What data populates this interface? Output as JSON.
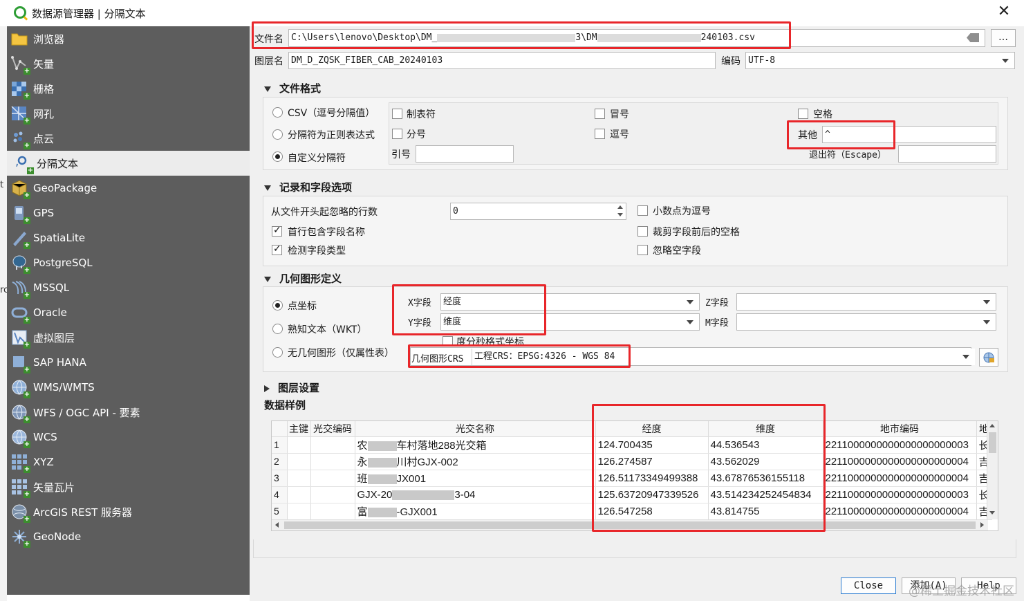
{
  "window": {
    "title": "数据源管理器 | 分隔文本",
    "close_symbol": "✕"
  },
  "left_edge": {
    "t": "t",
    "rc": "rc"
  },
  "sidebar": {
    "items": [
      {
        "label": "浏览器",
        "icon": "folder-icon"
      },
      {
        "label": "矢量",
        "icon": "vector-icon"
      },
      {
        "label": "栅格",
        "icon": "raster-icon"
      },
      {
        "label": "网孔",
        "icon": "mesh-icon"
      },
      {
        "label": "点云",
        "icon": "point-cloud-icon"
      },
      {
        "label": "分隔文本",
        "icon": "delimited-text-icon",
        "active": true
      },
      {
        "label": "GeoPackage",
        "icon": "geopackage-icon"
      },
      {
        "label": "GPS",
        "icon": "gps-icon"
      },
      {
        "label": "SpatiaLite",
        "icon": "spatialite-icon"
      },
      {
        "label": "PostgreSQL",
        "icon": "postgresql-icon"
      },
      {
        "label": "MSSQL",
        "icon": "mssql-icon"
      },
      {
        "label": "Oracle",
        "icon": "oracle-icon"
      },
      {
        "label": "虚拟图层",
        "icon": "virtual-layer-icon"
      },
      {
        "label": "SAP HANA",
        "icon": "sap-hana-icon"
      },
      {
        "label": "WMS/WMTS",
        "icon": "wms-icon"
      },
      {
        "label": "WFS / OGC API - 要素",
        "icon": "wfs-icon"
      },
      {
        "label": "WCS",
        "icon": "wcs-icon"
      },
      {
        "label": "XYZ",
        "icon": "xyz-icon"
      },
      {
        "label": "矢量瓦片",
        "icon": "vector-tile-icon"
      },
      {
        "label": "ArcGIS REST 服务器",
        "icon": "arcgis-icon"
      },
      {
        "label": "GeoNode",
        "icon": "geonode-icon"
      }
    ]
  },
  "file": {
    "label": "文件名",
    "value_start": "C:\\Users\\lenovo\\Desktop\\DM_",
    "value_mid": "3\\DM",
    "value_end": "240103.csv",
    "browse": "…"
  },
  "layer": {
    "label": "图层名",
    "value": "DM_D_ZQSK_FIBER_CAB_20240103",
    "encoding_label": "编码",
    "encoding": "UTF-8"
  },
  "file_format": {
    "title": "文件格式",
    "radio_csv": "CSV（逗号分隔值）",
    "radio_regex": "分隔符为正则表达式",
    "radio_custom": "自定义分隔符",
    "tab": "制表符",
    "colon": "冒号",
    "space": "空格",
    "semicolon": "分号",
    "comma": "逗号",
    "other_label": "其他",
    "other_value": "^",
    "quote_label": "引号",
    "escape_label": "退出符（Escape）"
  },
  "records": {
    "title": "记录和字段选项",
    "skip_label": "从文件开头起忽略的行数",
    "skip_value": "0",
    "first_row_header": "首行包含字段名称",
    "detect_types": "检测字段类型",
    "decimal_comma": "小数点为逗号",
    "trim_fields": "裁剪字段前后的空格",
    "discard_empty": "忽略空字段"
  },
  "geometry": {
    "title": "几何图形定义",
    "radio_point": "点坐标",
    "radio_wkt": "熟知文本（WKT）",
    "radio_none": "无几何图形（仅属性表）",
    "x_label": "X字段",
    "x_value": "经度",
    "y_label": "Y字段",
    "y_value": "维度",
    "z_label": "Z字段",
    "m_label": "M字段",
    "dms": "度分秒格式坐标",
    "crs_label": "几何图形CRS",
    "crs_value": "工程CRS：EPSG:4326 - WGS 84"
  },
  "layer_settings": {
    "title": "图层设置"
  },
  "sample": {
    "title": "数据样例",
    "columns": [
      "主键",
      "光交编码",
      "光交名称",
      "经度",
      "维度",
      "地市编码",
      "地"
    ],
    "rows": [
      {
        "n": "1",
        "name_pre": "农",
        "name_post": "车村落地288光交箱",
        "lon": "124.700435",
        "lat": "44.536543",
        "city": "2211000000000000000000003",
        "di": "长"
      },
      {
        "n": "2",
        "name_pre": "永",
        "name_post": "川村GJX-002",
        "lon": "126.274587",
        "lat": "43.562029",
        "city": "2211000000000000000000004",
        "di": "吉"
      },
      {
        "n": "3",
        "name_pre": "班",
        "name_post": "JX001",
        "lon": "126.51173349499388",
        "lat": "43.67876536155118",
        "city": "2211000000000000000000004",
        "di": "吉"
      },
      {
        "n": "4",
        "name_pre": "GJX-20",
        "name_post": "3-04",
        "lon": "125.63720947339526",
        "lat": "43.514234252454834",
        "city": "2211000000000000000000003",
        "di": "长"
      },
      {
        "n": "5",
        "name_pre": "富",
        "name_post": "-GJX001",
        "lon": "126.547258",
        "lat": "43.814755",
        "city": "2211000000000000000000004",
        "di": "吉"
      }
    ]
  },
  "buttons": {
    "close": "Close",
    "add": "添加(A)",
    "help": "Help"
  },
  "watermark": "@稀土掘金技术社区",
  "colors": {
    "sidebar_bg": "#5d5d5d",
    "highlight": "#e8262a",
    "content_bg": "#f0f0f0"
  }
}
